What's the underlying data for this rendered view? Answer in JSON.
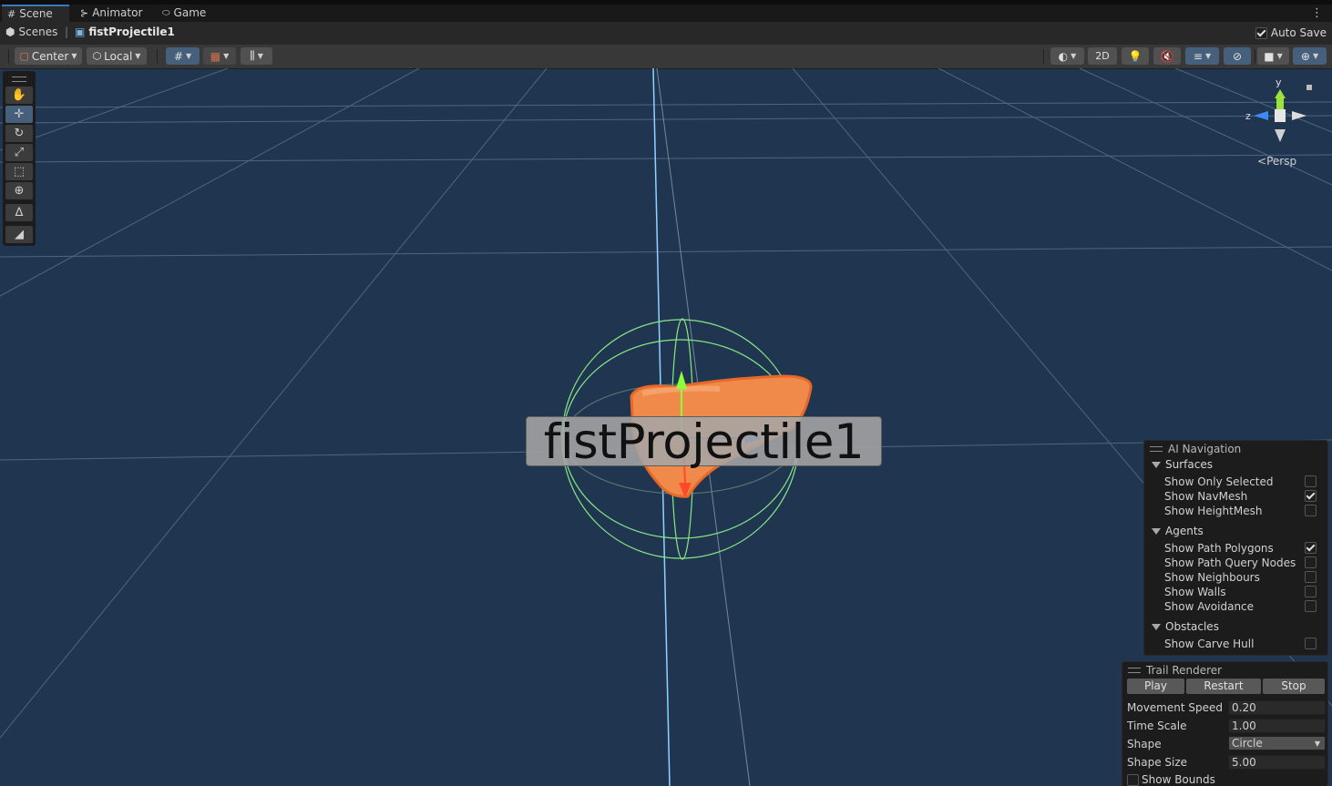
{
  "tabs": [
    {
      "label": "Scene",
      "icon": "grid-icon"
    },
    {
      "label": "Animator",
      "icon": "animator-icon"
    },
    {
      "label": "Game",
      "icon": "gamepad-icon"
    }
  ],
  "breadcrumb": {
    "root": "Scenes",
    "current": "fistProjectile1"
  },
  "auto_save": {
    "label": "Auto Save",
    "checked": true
  },
  "toolbar": {
    "pivot_label": "Center",
    "space_label": "Local",
    "mode_2d": "2D"
  },
  "gizmo": {
    "y": "y",
    "z": "z",
    "projection": "Persp"
  },
  "scene_object": {
    "name": "fistProjectile1"
  },
  "ai_navigation": {
    "title": "AI Navigation",
    "sections": [
      {
        "title": "Surfaces",
        "items": [
          {
            "label": "Show Only Selected",
            "checked": false
          },
          {
            "label": "Show NavMesh",
            "checked": true
          },
          {
            "label": "Show HeightMesh",
            "checked": false
          }
        ]
      },
      {
        "title": "Agents",
        "items": [
          {
            "label": "Show Path Polygons",
            "checked": true
          },
          {
            "label": "Show Path Query Nodes",
            "checked": false
          },
          {
            "label": "Show Neighbours",
            "checked": false
          },
          {
            "label": "Show Walls",
            "checked": false
          },
          {
            "label": "Show Avoidance",
            "checked": false
          }
        ]
      },
      {
        "title": "Obstacles",
        "items": [
          {
            "label": "Show Carve Hull",
            "checked": false
          }
        ]
      }
    ]
  },
  "trail_renderer": {
    "title": "Trail Renderer",
    "play": "Play",
    "restart": "Restart",
    "stop": "Stop",
    "fields": {
      "movement_speed": {
        "label": "Movement Speed",
        "value": "0.20"
      },
      "time_scale": {
        "label": "Time Scale",
        "value": "1.00"
      },
      "shape": {
        "label": "Shape",
        "value": "Circle"
      },
      "shape_size": {
        "label": "Shape Size",
        "value": "5.00"
      },
      "show_bounds": {
        "label": "Show Bounds",
        "checked": false
      }
    }
  },
  "colors": {
    "scene_background": "#203650",
    "selection_accent": "#46607c",
    "collider_green": "#7ee07e",
    "fist_orange": "#f08a4b"
  }
}
